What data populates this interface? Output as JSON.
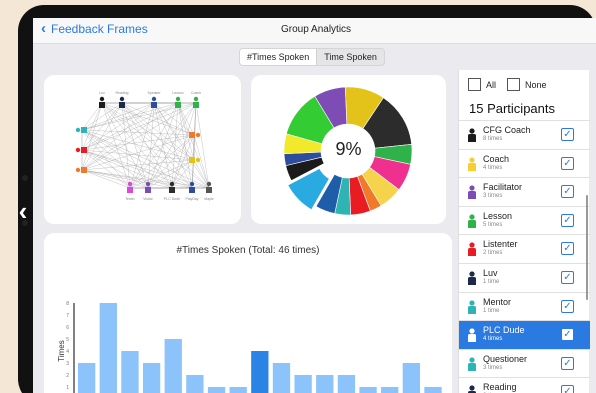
{
  "nav": {
    "back_label": "Feedback Frames",
    "title": "Group Analytics"
  },
  "segment": {
    "options": [
      "#Times Spoken",
      "Time Spoken"
    ],
    "selected": "#Times Spoken"
  },
  "network": {
    "top_labels": [
      "Luv",
      "Reading",
      "Speaker",
      "Lesson",
      "Coach"
    ],
    "bottom_labels": [
      "Tester",
      "Visitor",
      "PLC Dude",
      "PlayDay",
      "Maple"
    ]
  },
  "pie": {
    "center_label": "9%",
    "highlight_color": "#29abe2",
    "slices": [
      {
        "color": "#29abe2",
        "value": 9
      },
      {
        "color": "#1b1b1b",
        "value": 4
      },
      {
        "color": "#2f4d9d",
        "value": 3
      },
      {
        "color": "#f1e92a",
        "value": 5
      },
      {
        "color": "#33cc33",
        "value": 12
      },
      {
        "color": "#7d4db5",
        "value": 8
      },
      {
        "color": "#e3c21a",
        "value": 10
      },
      {
        "color": "#2c2c2c",
        "value": 14
      },
      {
        "color": "#2fb24a",
        "value": 5
      },
      {
        "color": "#f0308e",
        "value": 7
      },
      {
        "color": "#f5d34a",
        "value": 6
      },
      {
        "color": "#f07a2a",
        "value": 3
      },
      {
        "color": "#e81c22",
        "value": 5
      },
      {
        "color": "#2fb4b4",
        "value": 4
      },
      {
        "color": "#1f5da8",
        "value": 5
      }
    ]
  },
  "chart_data": {
    "type": "bar",
    "title": "#Times Spoken (Total: 46 times)",
    "ylabel": "Times",
    "ylim": [
      0,
      8
    ],
    "yticks": [
      "0",
      "1",
      "2",
      "3",
      "4",
      "5",
      "6",
      "7",
      "8"
    ],
    "values": [
      3,
      8,
      4,
      3,
      5,
      2,
      1,
      1,
      4,
      3,
      2,
      2,
      2,
      1,
      1,
      3,
      1
    ],
    "highlight_index": 8,
    "bar_color": "#8cc3fb",
    "highlight_color": "#2b83e6"
  },
  "panel": {
    "all_label": "All",
    "none_label": "None",
    "count_label": "15 Participants",
    "participants": [
      {
        "name": "CFG Coach",
        "times": "8 times",
        "color": "#1b1b1b",
        "selected": false,
        "checked": true
      },
      {
        "name": "Coach",
        "times": "4 times",
        "color": "#f5d030",
        "selected": false,
        "checked": true
      },
      {
        "name": "Facilitator",
        "times": "3 times",
        "color": "#7d4db5",
        "selected": false,
        "checked": true
      },
      {
        "name": "Lesson",
        "times": "5 times",
        "color": "#2fb24a",
        "selected": false,
        "checked": true
      },
      {
        "name": "Listenter",
        "times": "2 times",
        "color": "#e81c22",
        "selected": false,
        "checked": true
      },
      {
        "name": "Luv",
        "times": "1 time",
        "color": "#1b2a4a",
        "selected": false,
        "checked": true
      },
      {
        "name": "Mentor",
        "times": "1 time",
        "color": "#2fb4b4",
        "selected": false,
        "checked": true
      },
      {
        "name": "PLC Dude",
        "times": "4 times",
        "color": "#ffffff",
        "selected": true,
        "checked": true
      },
      {
        "name": "Questioner",
        "times": "3 times",
        "color": "#2fb4b4",
        "selected": false,
        "checked": true
      },
      {
        "name": "Reading",
        "times": "2 times",
        "color": "#1b2a4a",
        "selected": false,
        "checked": true
      }
    ],
    "check_glyph": "✓"
  }
}
